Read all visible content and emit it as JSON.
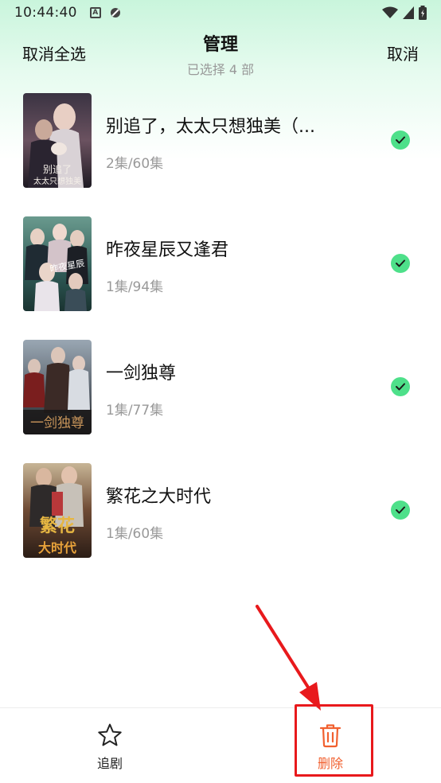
{
  "status_bar": {
    "time": "10:44:40"
  },
  "header": {
    "left_action": "取消全选",
    "title": "管理",
    "subtitle": "已选择 4 部",
    "right_action": "取消"
  },
  "list": [
    {
      "title": "别追了，太太只想独美（...",
      "progress": "2集/60集",
      "selected": true,
      "cover_text": "别追了太太只想独美"
    },
    {
      "title": "昨夜星辰又逢君",
      "progress": "1集/94集",
      "selected": true,
      "cover_text": "昨夜星辰"
    },
    {
      "title": "一剑独尊",
      "progress": "1集/77集",
      "selected": true,
      "cover_text": "一剑独尊"
    },
    {
      "title": "繁花之大时代",
      "progress": "1集/60集",
      "selected": true,
      "cover_text": "繁花大时代"
    }
  ],
  "bottom_bar": {
    "follow_label": "追剧",
    "delete_label": "删除"
  },
  "colors": {
    "accent_green": "#4ee08a",
    "delete_orange": "#f1602f",
    "annotation_red": "#e8191c"
  }
}
